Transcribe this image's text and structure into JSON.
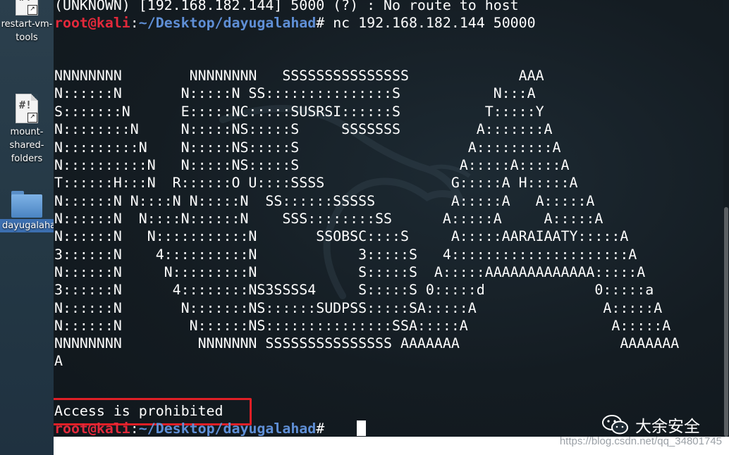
{
  "desktop": {
    "icons": [
      {
        "label": "restart-vm-\ntools",
        "icon": "script-file-icon"
      },
      {
        "label": "mount-\nshared-\nfolders",
        "icon": "script-file-icon"
      },
      {
        "label": "dayugalahad",
        "icon": "folder-icon"
      }
    ],
    "script_symbol": "#!",
    "shortcut_arrow": "↗"
  },
  "terminal": {
    "lines": [
      "(UNKNOWN) [192.168.182.144] 5000 (?) : No route to host",
      "",
      "",
      "",
      "NNNNNNNN        NNNNNNNN   SSSSSSSSSSSSSSS             AAA",
      "N::::::N       N:::::N SS:::::::::::::::S           N:::A",
      "S:::::::N      E:::::NC:::::SUSRSI::::::S          T:::::Y",
      "N::::::::N     N:::::NS:::::S     SSSSSSS         A:::::::A",
      "N:::::::::N    N:::::NS:::::S                    A:::::::::A",
      "N::::::::::N   N:::::NS:::::S                   A:::::A:::::A",
      "T::::::H:::N  R::::::O U::::SSSS               G:::::A H:::::A",
      "N::::::N N::::N N:::::N  SS::::::SSSSS         A:::::A   A:::::A",
      "N::::::N  N::::N::::::N    SSS::::::::SS      A:::::A     A:::::A",
      "N::::::N   N:::::::::::N       SSOBSC::::S     A:::::AARAIAATY:::::A",
      "3::::::N    4::::::::::N            3:::::S   4:::::::::::::::::::::A",
      "N::::::N     N:::::::::N            S:::::S  A:::::AAAAAAAAAAAAA:::::A",
      "3::::::N      4::::::::NS3SSSS4     S:::::S 0:::::d             0:::::a",
      "N::::::N       N:::::::NS::::::SUDPSS:::::SA:::::A               A:::::A",
      "N::::::N        N::::::NS:::::::::::::::SSA:::::A                 A:::::A",
      "NNNNNNNN         NNNNNNN SSSSSSSSSSSSSSS AAAAAAA                   AAAAAAA",
      "A",
      "",
      "",
      "Access is prohibited"
    ],
    "prompt_top": {
      "user": "root@kali",
      "sep": ":",
      "path": "~/Desktop/dayugalahad",
      "symbol": "# ",
      "command": "nc 192.168.182.144 50000"
    },
    "prompt_bottom": {
      "user": "root@kali",
      "sep": ":",
      "path": "~/Desktop/dayugalahad",
      "symbol": "# ",
      "command": ""
    }
  },
  "watermark": {
    "brand": "大余安全",
    "url": "https://blog.csdn.net/qq_34801745"
  },
  "colors": {
    "user": "#e2293b",
    "path": "#5f8fd6",
    "highlight": "#e01f26"
  }
}
